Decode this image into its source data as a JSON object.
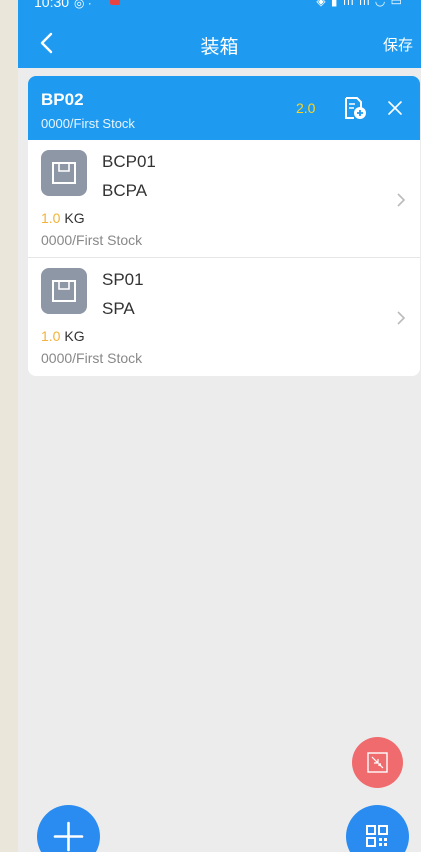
{
  "status_bar": {
    "time": "10:30"
  },
  "header": {
    "title": "装箱",
    "save_label": "保存"
  },
  "package": {
    "code": "BP02",
    "location": "0000/First Stock",
    "weight": "2.0"
  },
  "items": [
    {
      "code": "BCP01",
      "name": "BCPA",
      "weight_value": "1.0",
      "weight_unit": "KG",
      "location": "0000/First Stock"
    },
    {
      "code": "SP01",
      "name": "SPA",
      "weight_value": "1.0",
      "weight_unit": "KG",
      "location": "0000/First Stock"
    }
  ],
  "icons": {
    "back": "chevron-left-icon",
    "package_doc": "document-add-icon",
    "close": "close-icon",
    "item": "box-icon",
    "chevron": "chevron-right-icon",
    "collapse": "collapse-icon",
    "add": "plus-icon",
    "scan": "qr-code-icon"
  },
  "colors": {
    "primary": "#1e9bf0",
    "weight_highlight": "#ffd320",
    "item_weight": "#f3b23b",
    "fab_red": "#ef6b6d",
    "fab_blue": "#2a8cf0"
  }
}
